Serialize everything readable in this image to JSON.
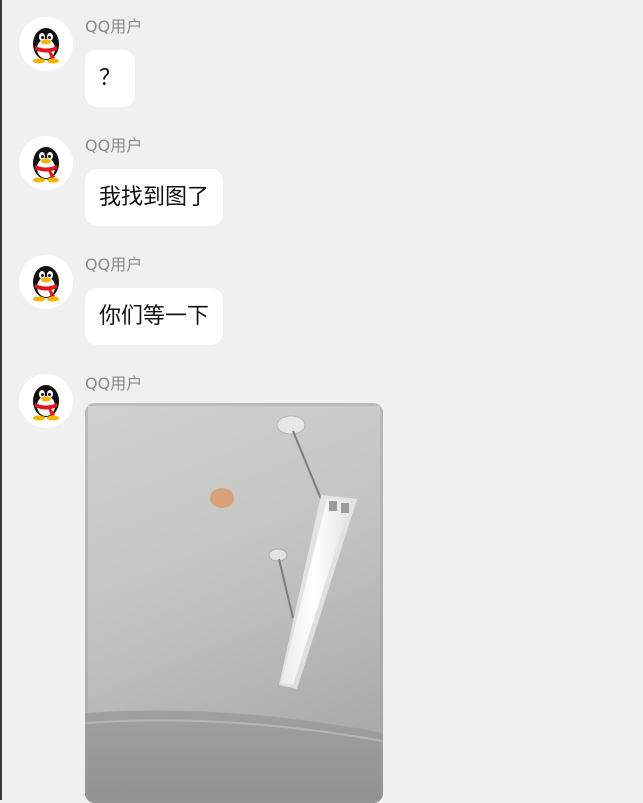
{
  "colors": {
    "background": "#f0f0f0",
    "bubble": "#ffffff",
    "sender_text": "#8a8a8a",
    "message_text": "#111111"
  },
  "messages": [
    {
      "sender": "QQ用户",
      "avatar_icon": "qq-penguin-icon",
      "type": "text",
      "text": "？"
    },
    {
      "sender": "QQ用户",
      "avatar_icon": "qq-penguin-icon",
      "type": "text",
      "text": "我找到图了"
    },
    {
      "sender": "QQ用户",
      "avatar_icon": "qq-penguin-icon",
      "type": "text",
      "text": "你们等一下"
    },
    {
      "sender": "QQ用户",
      "avatar_icon": "qq-penguin-icon",
      "type": "image"
    }
  ]
}
